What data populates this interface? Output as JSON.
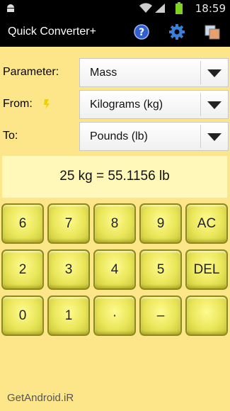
{
  "status": {
    "time": "18:59"
  },
  "app": {
    "title": "Quick Converter+"
  },
  "form": {
    "parameter_label": "Parameter:",
    "parameter_value": "Mass",
    "from_label": "From:",
    "from_value": "Kilograms (kg)",
    "to_label": "To:",
    "to_value": "Pounds (lb)"
  },
  "result": "25 kg = 55.1156 lb",
  "keypad": {
    "rows": [
      [
        "6",
        "7",
        "8",
        "9",
        "AC"
      ],
      [
        "2",
        "3",
        "4",
        "5",
        "DEL"
      ],
      [
        "0",
        "1",
        "·",
        "–",
        ""
      ]
    ]
  },
  "watermark": "GetAndroid.iR",
  "colors": {
    "background": "#fde68a",
    "key": "#eae65a",
    "bars": "#000000"
  }
}
